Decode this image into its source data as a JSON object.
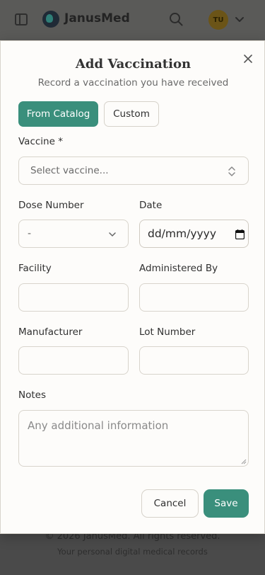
{
  "app": {
    "brand": "JanusMed",
    "avatar_initials": "TU",
    "footer_copyright": "© 2026 JanusMed. All rights reserved.",
    "footer_tagline": "Your personal digital medical records"
  },
  "modal": {
    "title": "Add Vaccination",
    "subtitle": "Record a vaccination you have received",
    "tabs": [
      {
        "label": "From Catalog",
        "active": true
      },
      {
        "label": "Custom",
        "active": false
      }
    ],
    "fields": {
      "vaccine": {
        "label": "Vaccine *",
        "placeholder": "Select vaccine..."
      },
      "dose_number": {
        "label": "Dose Number",
        "value": "-"
      },
      "date": {
        "label": "Date",
        "value": "dd/mm/yyyy"
      },
      "facility": {
        "label": "Facility",
        "value": ""
      },
      "administered_by": {
        "label": "Administered By",
        "value": ""
      },
      "manufacturer": {
        "label": "Manufacturer",
        "value": ""
      },
      "lot_number": {
        "label": "Lot Number",
        "value": ""
      },
      "notes": {
        "label": "Notes",
        "placeholder": "Any additional information"
      }
    },
    "actions": {
      "cancel": "Cancel",
      "save": "Save"
    }
  },
  "colors": {
    "accent": "#3a8f7c",
    "overlay": "#4a4a4a",
    "surface": "#fdfcfa"
  }
}
